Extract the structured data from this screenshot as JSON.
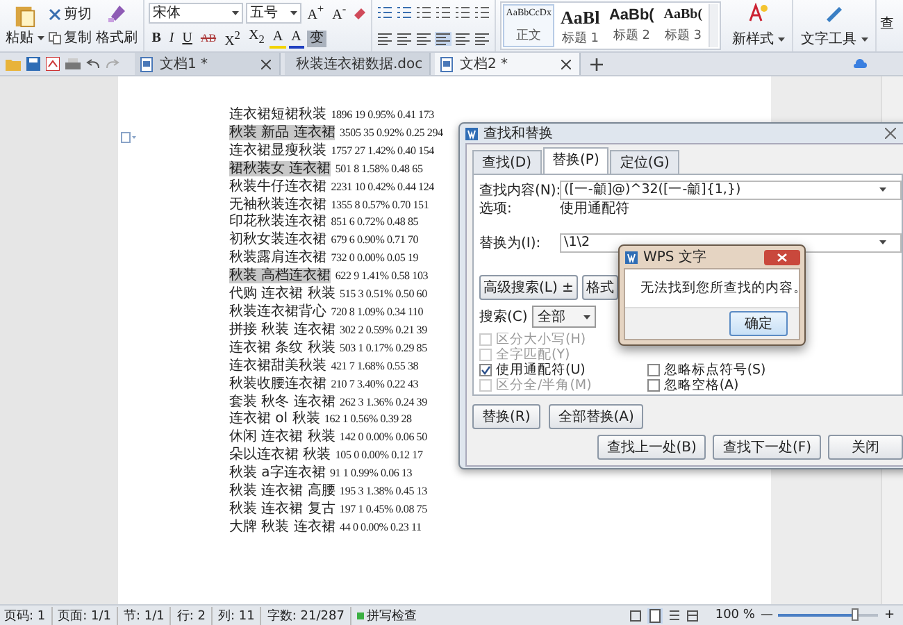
{
  "ribbon": {
    "clipboard": {
      "paste": "粘贴",
      "cut": "剪切",
      "copy": "复制",
      "format_painter": "格式刷"
    },
    "font": {
      "family": "宋体",
      "size": "五号",
      "grow": "A$^{+}$",
      "shrink": "A$^{-}$",
      "format_buttons": [
        "B",
        "I",
        "U",
        "AB",
        "X$^{2}$",
        "X$_{2}$"
      ],
      "color_buttons": [
        "A",
        "A",
        "变"
      ]
    },
    "styles": [
      {
        "preview": "AaBbCcDx",
        "name": "正文",
        "selected": true
      },
      {
        "preview": "AaBl",
        "name": "标题 1",
        "selected": false
      },
      {
        "preview": "AaBb(",
        "name": "标题 2",
        "selected": false
      },
      {
        "preview": "AaBb(",
        "name": "标题 3",
        "selected": false
      }
    ],
    "new_style": "新样式",
    "text_tools": "文字工具",
    "cut_off_item": "查"
  },
  "tabs": [
    {
      "title": "文档1 *",
      "selected": false
    },
    {
      "title": "秋装连衣裙数据.doc",
      "selected": false
    },
    {
      "title": "文档2 *",
      "selected": true
    }
  ],
  "document": {
    "lines": [
      {
        "term": "连衣裙短裙秋装",
        "stats": "1896 19 0.95% 0.41 173",
        "highlighted": false
      },
      {
        "term": "秋装 新品 连衣裙",
        "stats": "3505 35 0.92% 0.25 294",
        "highlighted": true
      },
      {
        "term": "连衣裙显瘦秋装",
        "stats": "1757 27 1.42% 0.40 154",
        "highlighted": false
      },
      {
        "term": "裙秋装女 连衣裙",
        "stats": "501 8 1.58% 0.48 65",
        "highlighted": true
      },
      {
        "term": "秋装牛仔连衣裙",
        "stats": "2231 10 0.42% 0.44 124",
        "highlighted": false
      },
      {
        "term": "无袖秋装连衣裙",
        "stats": "1355 8 0.57% 0.70 151",
        "highlighted": false
      },
      {
        "term": "印花秋装连衣裙",
        "stats": "851 6 0.72% 0.48 85",
        "highlighted": false
      },
      {
        "term": "初秋女装连衣裙",
        "stats": "679 6 0.90% 0.71 70",
        "highlighted": false
      },
      {
        "term": "秋装露肩连衣裙",
        "stats": "732 0 0.00% 0.05 19",
        "highlighted": false
      },
      {
        "term": "秋装 高档连衣裙",
        "stats": "622 9 1.41% 0.58 103",
        "highlighted": true
      },
      {
        "term": "代购 连衣裙 秋装",
        "stats": "515 3 0.51% 0.50 60",
        "highlighted": false
      },
      {
        "term": "秋装连衣裙背心",
        "stats": "720 8 1.09% 0.34 110",
        "highlighted": false
      },
      {
        "term": "拼接 秋装 连衣裙",
        "stats": "302 2 0.59% 0.21 39",
        "highlighted": false
      },
      {
        "term": "连衣裙 条纹 秋装",
        "stats": "503 1 0.17% 0.29 85",
        "highlighted": false
      },
      {
        "term": "连衣裙甜美秋装",
        "stats": "421 7 1.68% 0.55 38",
        "highlighted": false
      },
      {
        "term": "秋装收腰连衣裙",
        "stats": "210 7 3.40% 0.22 43",
        "highlighted": false
      },
      {
        "term": "套装 秋冬 连衣裙",
        "stats": "262 3 1.36% 0.24 39",
        "highlighted": false
      },
      {
        "term": "连衣裙 ol 秋装",
        "stats": "162 1 0.56% 0.39 28",
        "highlighted": false
      },
      {
        "term": "休闲 连衣裙 秋装",
        "stats": "142 0 0.00% 0.06 50",
        "highlighted": false
      },
      {
        "term": "朵以连衣裙 秋装",
        "stats": "105 0 0.00% 0.12 17",
        "highlighted": false
      },
      {
        "term": "秋装 a字连衣裙",
        "stats": "91 1 0.99% 0.06 13",
        "highlighted": false
      },
      {
        "term": "秋装 连衣裙 高腰",
        "stats": "195 3 1.38% 0.45 13",
        "highlighted": false
      },
      {
        "term": "秋装 连衣裙 复古",
        "stats": "197 1 0.45% 0.08 75",
        "highlighted": false
      },
      {
        "term": "大牌 秋装 连衣裙",
        "stats": "44 0 0.00% 0.23 11",
        "highlighted": false
      }
    ]
  },
  "find_dialog": {
    "title": "查找和替换",
    "tabs": [
      {
        "label": "查找(D)",
        "selected": false
      },
      {
        "label": "替换(P)",
        "selected": true
      },
      {
        "label": "定位(G)",
        "selected": false
      }
    ],
    "find_label": "查找内容(N):",
    "find_value": "([一-龥]@)^32([一-龥]{1,})",
    "options_label": "选项:",
    "options_value": "使用通配符",
    "replace_label": "替换为(I):",
    "replace_value": "\\1\\2",
    "advanced_button": "高级搜索(L) ±",
    "format_button": "格式",
    "search_label": "搜索(C)",
    "search_value": "全部",
    "left_checkboxes": [
      {
        "label": "区分大小写(H)",
        "checked": false,
        "disabled": true
      },
      {
        "label": "全字匹配(Y)",
        "checked": false,
        "disabled": true
      },
      {
        "label": "使用通配符(U)",
        "checked": true,
        "disabled": false
      },
      {
        "label": "区分全/半角(M)",
        "checked": false,
        "disabled": true
      }
    ],
    "right_checkboxes": [
      {
        "label": "忽略标点符号(S)",
        "checked": false,
        "disabled": false
      },
      {
        "label": "忽略空格(A)",
        "checked": false,
        "disabled": false
      }
    ],
    "replace_buttons": [
      "替换(R)",
      "全部替换(A)"
    ],
    "nav_buttons": [
      "查找上一处(B)",
      "查找下一处(F)",
      "关闭"
    ]
  },
  "message_box": {
    "title": "WPS 文字",
    "message": "无法找到您所查找的内容。",
    "button": "确定"
  },
  "status_bar": {
    "items": [
      "页码: 1",
      "页面: 1/1",
      "节: 1/1",
      "行: 2",
      "列: 11",
      "字数: 21/287"
    ],
    "spell_check": "拼写检查",
    "zoom": "100 %",
    "zoom_minus": "—",
    "zoom_plus": "+",
    "zoom_slider": {
      "level": 0.77
    }
  }
}
